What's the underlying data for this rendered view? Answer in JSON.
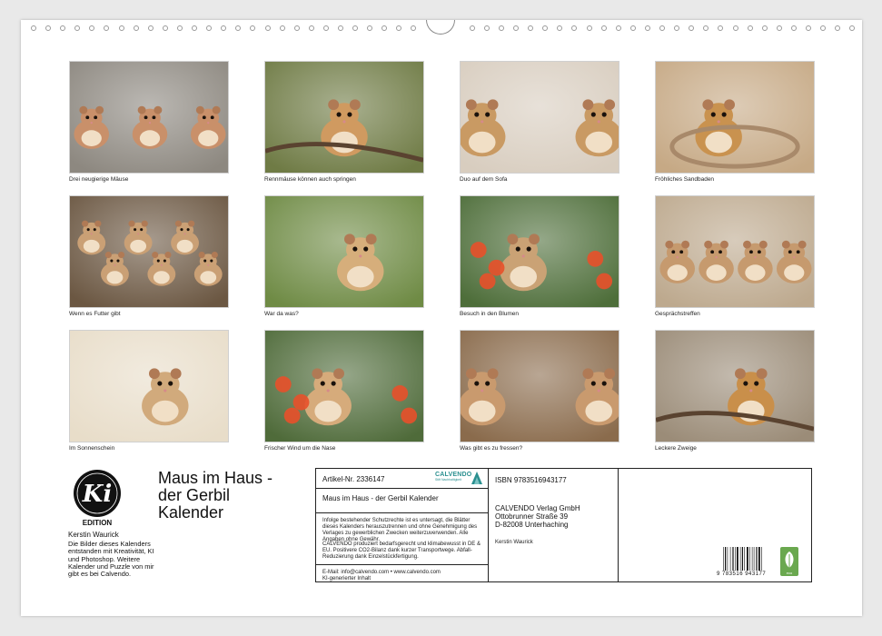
{
  "calendar": {
    "title": "Maus im Haus - der Gerbil Kalender",
    "title_lines": [
      "Maus im Haus -",
      "der Gerbil",
      "Kalender"
    ],
    "logo_letters": "Ki",
    "logo_edition": "EDITION",
    "author": "Kerstin Waurick",
    "description": "Die Bilder dieses Kalenders entstanden mit Kreativität, KI und Photoshop. Weitere Kalender und Puzzle von mir gibt es bei Calvendo."
  },
  "photos": [
    {
      "caption": "Drei neugierige Mäuse",
      "bg": "#8d8880",
      "fg": "#c9906a",
      "icon": "three-gerbils"
    },
    {
      "caption": "Rennmäuse können auch springen",
      "bg": "#6f7b45",
      "fg": "#d09a60",
      "icon": "jumping-gerbil"
    },
    {
      "caption": "Duo auf dem Sofa",
      "bg": "#d8cdbf",
      "fg": "#c99a63",
      "icon": "two-gerbils"
    },
    {
      "caption": "Fröhliches Sandbaden",
      "bg": "#c6a985",
      "fg": "#c9924f",
      "icon": "gerbil-in-bowl"
    },
    {
      "caption": "Wenn es Futter gibt",
      "bg": "#6b5742",
      "fg": "#caa075",
      "icon": "many-gerbils"
    },
    {
      "caption": "War da was?",
      "bg": "#6f8b45",
      "fg": "#d6ae7b",
      "icon": "gerbil-portrait"
    },
    {
      "caption": "Besuch in den Blumen",
      "bg": "#4e6e3a",
      "fg": "#caa275",
      "icon": "gerbil-flowers"
    },
    {
      "caption": "Gesprächstreffen",
      "bg": "#bda98e",
      "fg": "#c69a6e",
      "icon": "gerbil-group"
    },
    {
      "caption": "Im Sonnenschein",
      "bg": "#e8ddc9",
      "fg": "#d1aa7c",
      "icon": "gerbil-sunshine"
    },
    {
      "caption": "Frischer Wind um die Nase",
      "bg": "#4f6b3a",
      "fg": "#d6ab7b",
      "icon": "gerbil-red-flower"
    },
    {
      "caption": "Was gibt es zu fressen?",
      "bg": "#8a6b4c",
      "fg": "#c99a6e",
      "icon": "gerbil-pair-food"
    },
    {
      "caption": "Leckere Zweige",
      "bg": "#9b8c78",
      "fg": "#c98f4a",
      "icon": "gerbil-twig"
    }
  ],
  "info": {
    "article": "Artikel-Nr. 2336147",
    "publisher_logo": "CALVENDO",
    "publisher_logo_sub": "Stift Nachhaltigkeit",
    "calendar_name": "Maus im Haus - der Gerbil Kalender",
    "legal": "Infolge bestehender Schutzrechte ist es untersagt, die Blätter dieses Kalenders herauszutrennen und ohne Genehmigung des Verlages zu gewerblichen Zwecken weiterzuverwenden. Alle Angaben ohne Gewähr.",
    "eco": "CALVENDO produziert bedarfsgerecht und klimabewusst in DE & EU. Positivere CO2-Bilanz dank kurzer Transportwege. Abfall-Reduzierung dank Einzelstückfertigung.",
    "contact": "E-Mail: info@calvendo.com • www.calvendo.com",
    "ai_note": "KI-generierter Inhalt",
    "isbn": "ISBN 9783516943177",
    "publisher": "CALVENDO Verlag GmbH",
    "street": "Ottobrunner Straße 39",
    "city": "D-82008 Unterhaching",
    "author": "Kerstin Waurick",
    "barcode_digits": "9 783516 943177"
  },
  "colors": {
    "calvendo_teal": "#2a8f8f",
    "eco_green": "#6aa84f"
  }
}
